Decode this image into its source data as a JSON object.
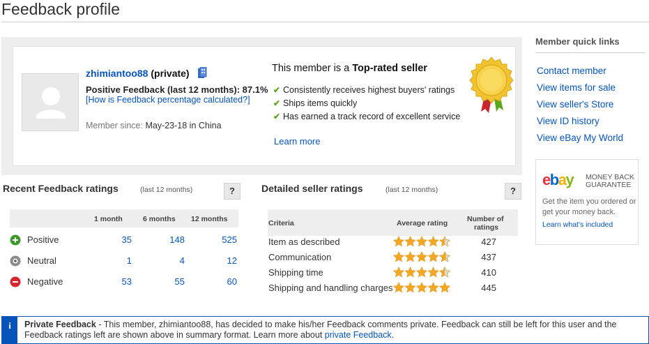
{
  "page": {
    "title": "Feedback profile"
  },
  "profile": {
    "username": "zhimiantoo88",
    "privacy": "(private)",
    "positive_feedback": "Positive Feedback (last 12 months): 87.1%",
    "how_link": "[How is Feedback percentage calculated?]",
    "member_since_label": "Member since: ",
    "member_since_value": "May-23-18 in China"
  },
  "top_rated": {
    "title_prefix": "This member is a ",
    "title_bold": "Top-rated seller",
    "items": [
      "Consistently receives highest buyers' ratings",
      "Ships items quickly",
      "Has earned a track record of excellent service"
    ],
    "learn_more": "Learn more"
  },
  "quick_links": {
    "title": "Member quick links",
    "items": [
      "Contact member",
      "View items for sale",
      "View seller's Store",
      "View ID history",
      "View eBay My World"
    ]
  },
  "mbg": {
    "logo_e": "e",
    "logo_b": "b",
    "logo_a": "a",
    "logo_y": "y",
    "line1": "MONEY BACK",
    "line2": "GUARANTEE",
    "desc": "Get the item you ordered or get your money back.",
    "link": "Learn what's included"
  },
  "recent_feedback": {
    "title": "Recent Feedback ratings",
    "subtitle": "(last 12 months)",
    "help": "?",
    "columns": [
      "1 month",
      "6 months",
      "12 months"
    ],
    "rows": [
      {
        "label": "Positive",
        "values": [
          "35",
          "148",
          "525"
        ],
        "color": "#3a9a2a"
      },
      {
        "label": "Neutral",
        "values": [
          "1",
          "4",
          "12"
        ],
        "color": "#8a8a8a"
      },
      {
        "label": "Negative",
        "values": [
          "53",
          "55",
          "60"
        ],
        "color": "#d4262c"
      }
    ]
  },
  "dsr": {
    "title": "Detailed seller ratings",
    "subtitle": "(last 12 months)",
    "help": "?",
    "col_criteria": "Criteria",
    "col_avg": "Average rating",
    "col_num_1": "Number of",
    "col_num_2": "ratings",
    "star_color": "#f5a623",
    "rows": [
      {
        "criteria": "Item as described",
        "rating": 4.5,
        "count": "427"
      },
      {
        "criteria": "Communication",
        "rating": 4.6,
        "count": "437"
      },
      {
        "criteria": "Shipping time",
        "rating": 4.5,
        "count": "410"
      },
      {
        "criteria": "Shipping and handling charges",
        "rating": 5.0,
        "count": "445"
      }
    ]
  },
  "info": {
    "icon": "i",
    "bold": "Private Feedback",
    "text": " - This member, zhimiantoo88, has decided to make his/her Feedback comments private. Feedback can still be left for this user and the Feedback ratings left are shown above in summary format. Learn more about ",
    "link": "private Feedback",
    "end": "."
  }
}
